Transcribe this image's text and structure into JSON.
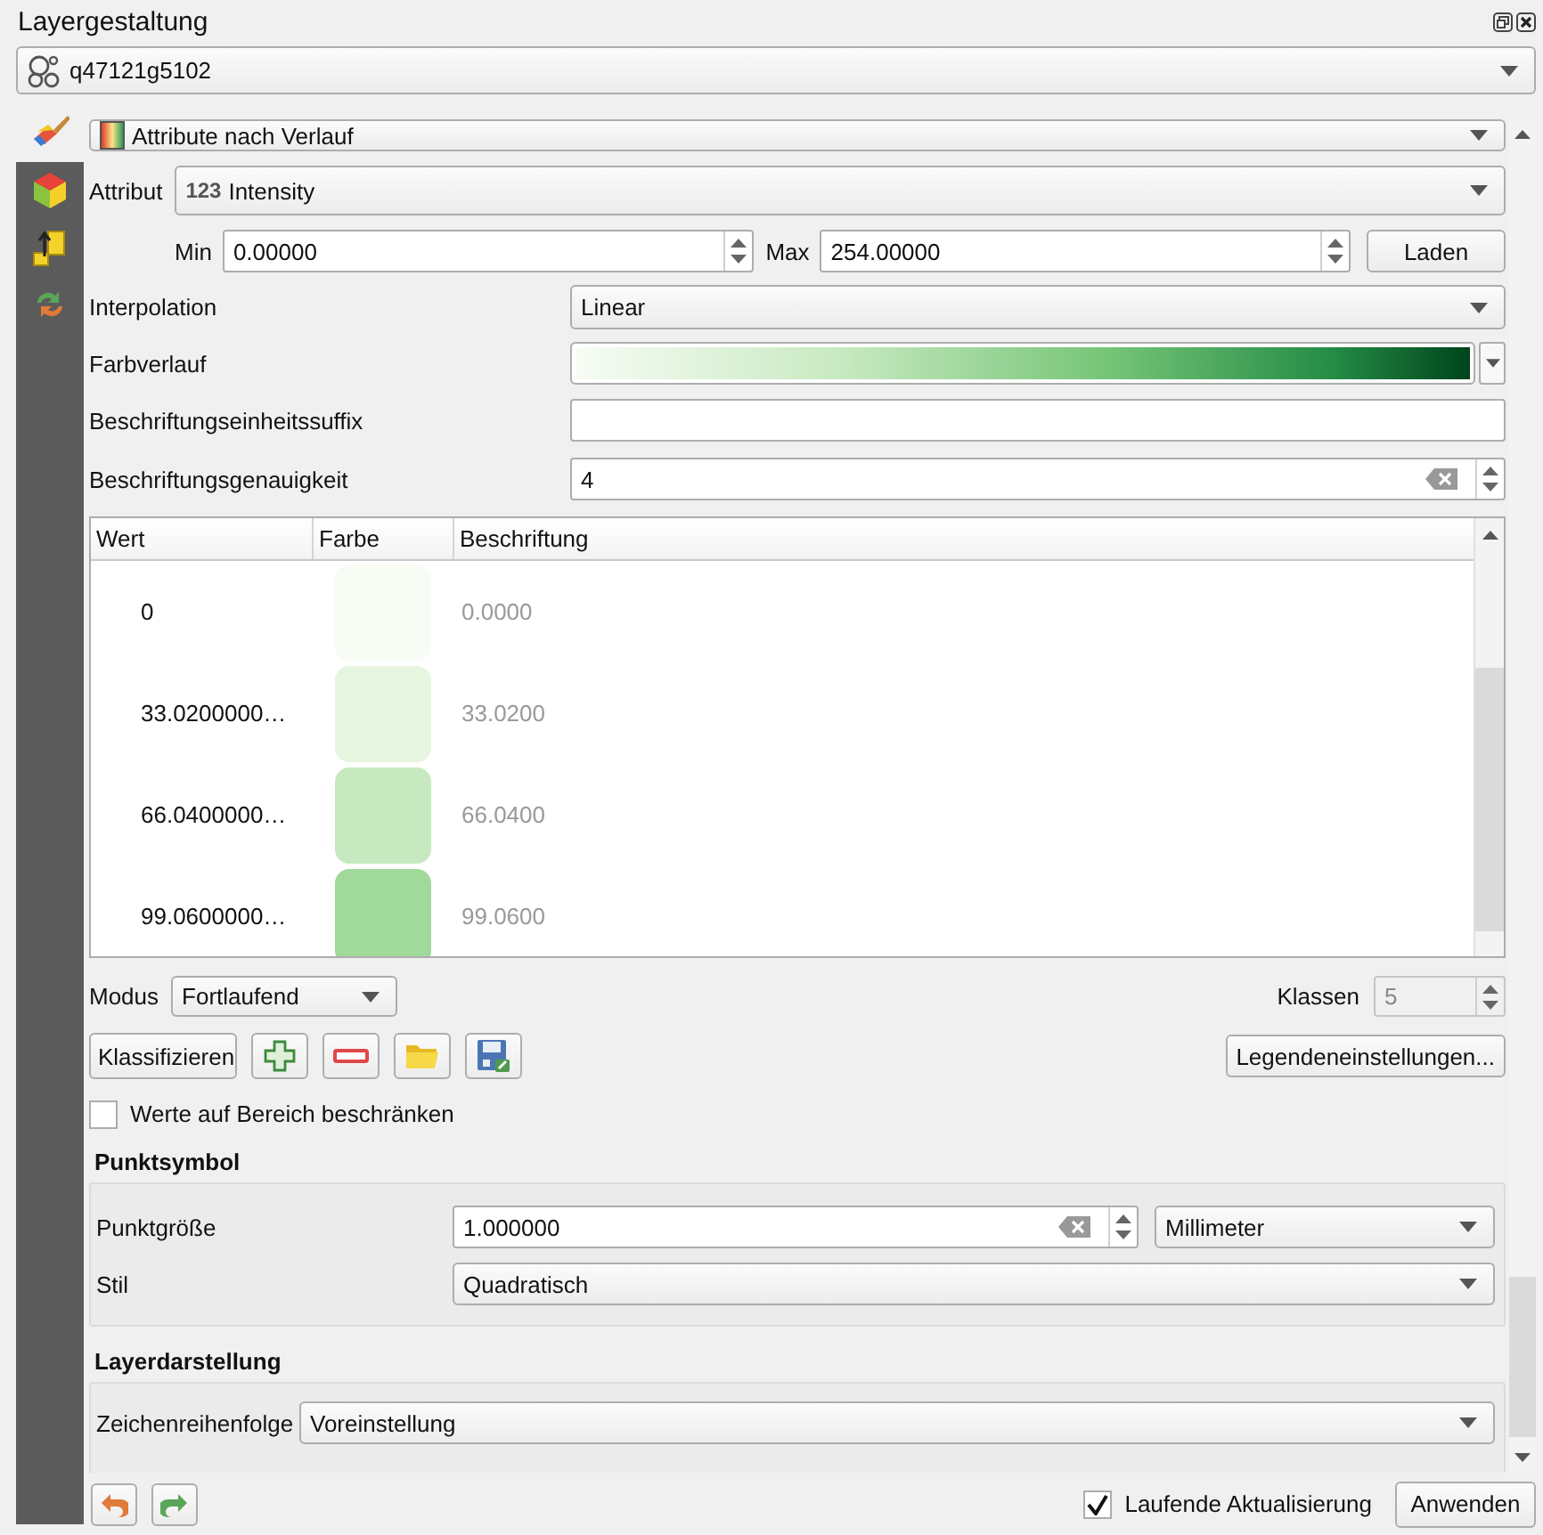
{
  "panel": {
    "title": "Layergestaltung"
  },
  "layer_selector": {
    "value": "q47121g5102"
  },
  "side_tabs": [
    {
      "kind": "symbology",
      "selected": true
    },
    {
      "kind": "cube",
      "selected": false
    },
    {
      "kind": "labels",
      "selected": false
    },
    {
      "kind": "history",
      "selected": false
    }
  ],
  "renderer": {
    "value": "Attribute nach Verlauf"
  },
  "attribute": {
    "label": "Attribut",
    "type_badge": "123",
    "value": "Intensity"
  },
  "min": {
    "label": "Min",
    "value": "0.00000"
  },
  "max": {
    "label": "Max",
    "value": "254.00000"
  },
  "load_button": "Laden",
  "interpolation": {
    "label": "Interpolation",
    "value": "Linear"
  },
  "color_ramp": {
    "label": "Farbverlauf"
  },
  "unit_suffix": {
    "label": "Beschriftungseinheitssuffix"
  },
  "precision": {
    "label": "Beschriftungsgenauigkeit",
    "value": "4"
  },
  "table": {
    "columns": [
      "Wert",
      "Farbe",
      "Beschriftung"
    ],
    "rows": [
      {
        "value": "0",
        "color": "#f7fcf5",
        "label": "0.0000"
      },
      {
        "value": "33.0200000…",
        "color": "#e5f5e0",
        "label": "33.0200"
      },
      {
        "value": "66.0400000…",
        "color": "#c7e9c0",
        "label": "66.0400"
      },
      {
        "value": "99.0600000…",
        "color": "#a1d99b",
        "label": "99.0600"
      }
    ]
  },
  "mode": {
    "label": "Modus",
    "value": "Fortlaufend"
  },
  "classes": {
    "label": "Klassen",
    "value": "5",
    "disabled": true
  },
  "classify_button": "Klassifizieren",
  "legend_button": "Legendeneinstellungen...",
  "clip_checkbox": {
    "label": "Werte auf Bereich beschränken",
    "checked": false
  },
  "point_symbol": {
    "heading": "Punktsymbol",
    "size": {
      "label": "Punktgröße",
      "value": "1.000000",
      "unit": "Millimeter"
    },
    "style": {
      "label": "Stil",
      "value": "Quadratisch"
    }
  },
  "layer_rendering": {
    "heading": "Layerdarstellung",
    "draw_order": {
      "label": "Zeichenreihenfolge",
      "value": "Voreinstellung"
    }
  },
  "live_update": {
    "label": "Laufende Aktualisierung",
    "checked": true
  },
  "apply_button": "Anwenden"
}
